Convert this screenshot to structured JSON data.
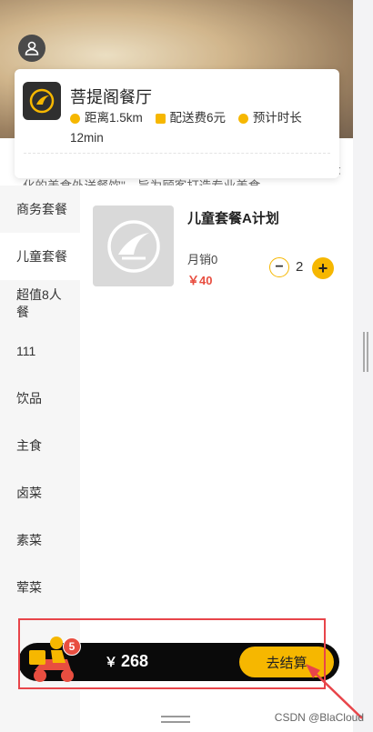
{
  "shop": {
    "name": "菩提阁餐厅",
    "distance": "距离1.5km",
    "delivery_fee": "配送费6元",
    "eta_label": "预计时长",
    "eta_value": "12min",
    "intro": "简介: 菩提阁中餐厅是菩提阁点餐的独立的品牌，定位\"大众 化的美食外送餐饮\"，旨为顾客打造专业美食。"
  },
  "categories": [
    {
      "label": "商务套餐",
      "active": false
    },
    {
      "label": "儿童套餐",
      "active": true
    },
    {
      "label": "超值8人餐",
      "active": false
    },
    {
      "label": "111",
      "active": false
    },
    {
      "label": "饮品",
      "active": false
    },
    {
      "label": "主食",
      "active": false
    },
    {
      "label": "卤菜",
      "active": false
    },
    {
      "label": "素菜",
      "active": false
    },
    {
      "label": "荤菜",
      "active": false
    }
  ],
  "dish": {
    "name": "儿童套餐A计划",
    "sales": "月销0",
    "price": "￥40",
    "quantity": "2"
  },
  "cart": {
    "count": "5",
    "total_symbol": "￥",
    "total": "268",
    "checkout_label": "去结算"
  },
  "watermark": "CSDN @BlaCloud",
  "colors": {
    "accent": "#f6b700",
    "price": "#e84e40",
    "annotation": "#e8454a"
  }
}
